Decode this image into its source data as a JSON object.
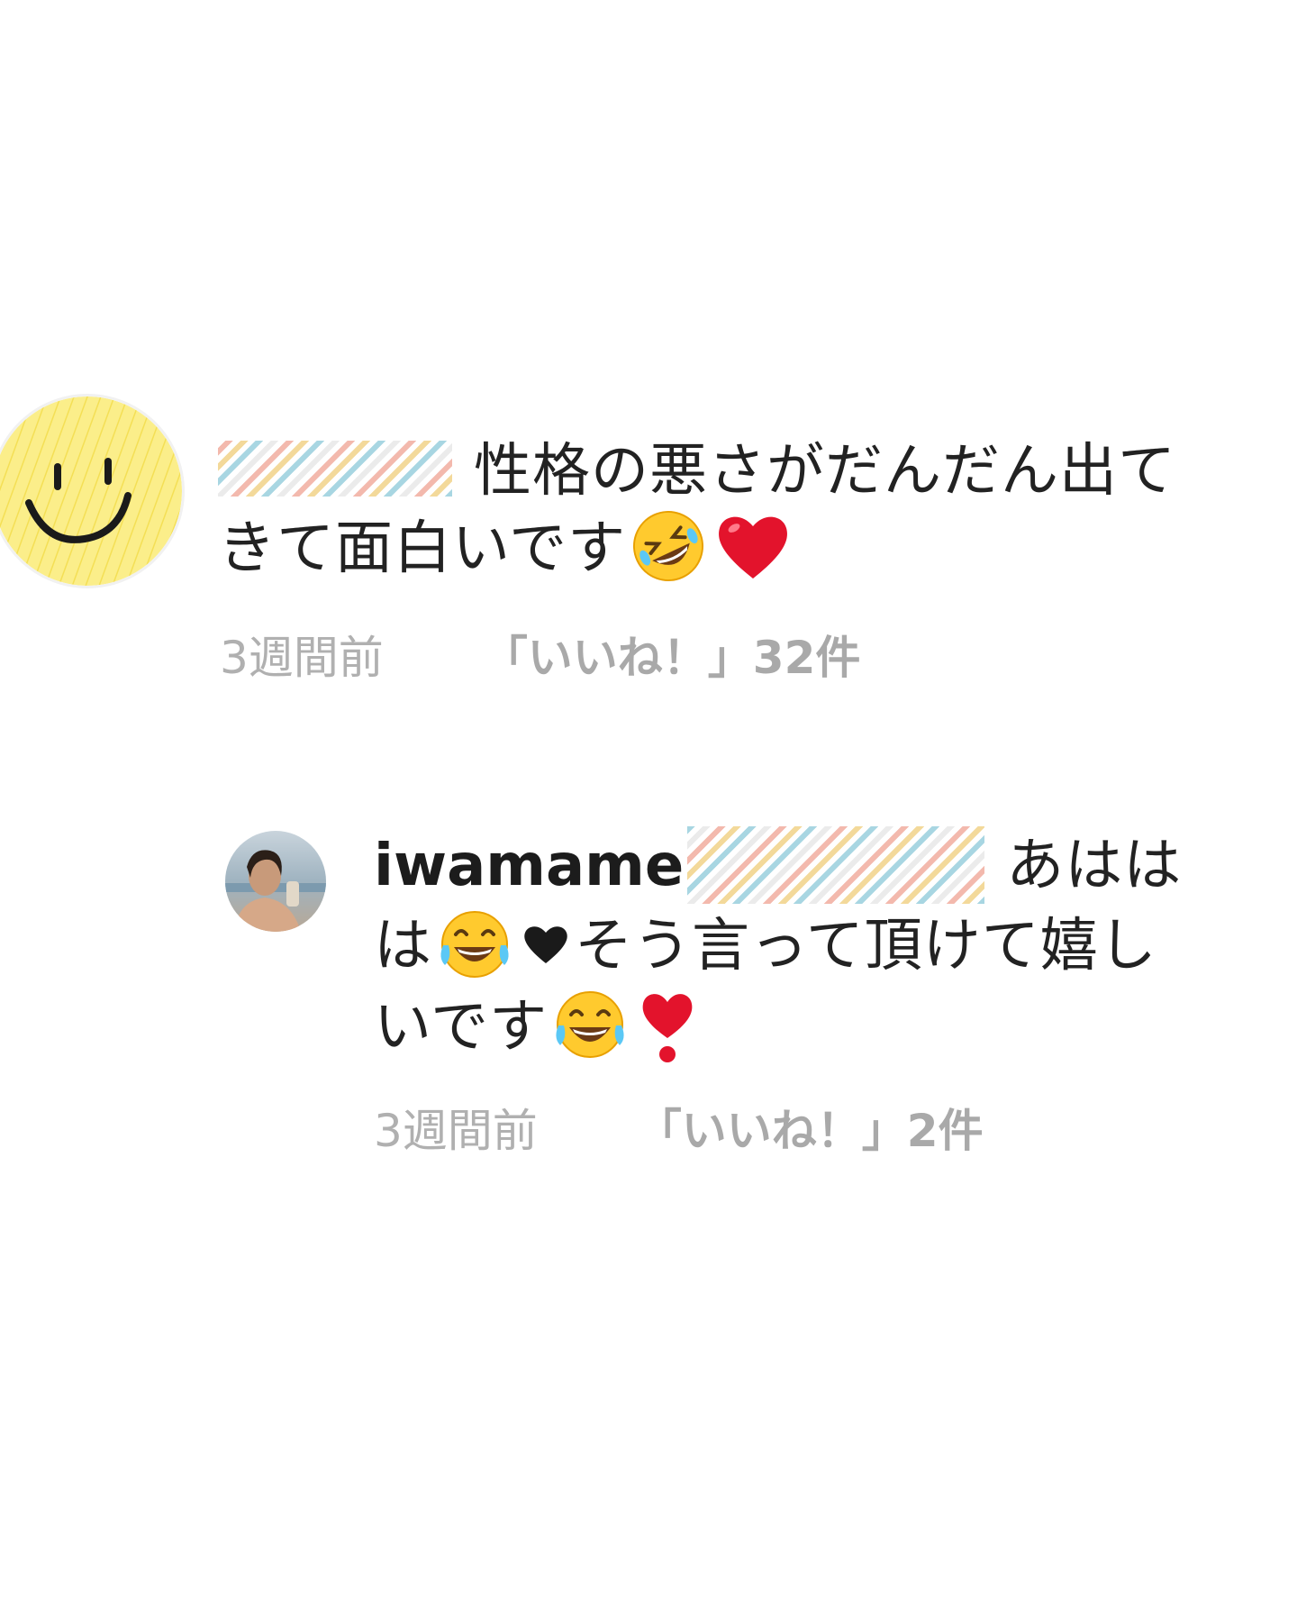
{
  "comments": [
    {
      "username": "",
      "text_line1": "性格の悪さがだんだん出て",
      "text_line2": "きて面白いです",
      "emojis": [
        "rolling-on-floor-laughing",
        "red-heart"
      ],
      "time": "3週間前",
      "likes": "「いいね！」32件",
      "avatar": "smiley-face-icon"
    },
    {
      "username": "iwamame",
      "text_line1": "あはは",
      "text_part2a": "は",
      "text_part2b": "そう言って頂けて嬉し",
      "text_line3": "いです",
      "emojis": [
        "face-with-tears-of-joy",
        "black-heart",
        "face-with-tears-of-joy",
        "heavy-heart-exclamation"
      ],
      "time": "3週間前",
      "likes": "「いいね！」2件",
      "avatar": "profile-photo"
    }
  ],
  "colors": {
    "text": "#222222",
    "meta": "#a9a9a9",
    "redact_blue": "#a8d6e2",
    "redact_yellow": "#f3d99a",
    "redact_pink": "#f3b9ad",
    "avatar_yellow": "#fbef8c",
    "heart_red": "#e3132c"
  }
}
